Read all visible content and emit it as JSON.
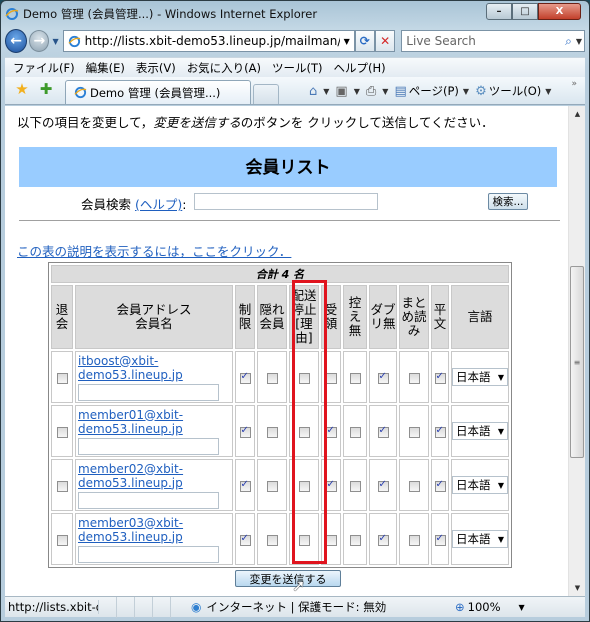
{
  "window": {
    "title": "Demo 管理 (会員管理...) - Windows Internet Explorer",
    "controls": {
      "minimize": "–",
      "maximize": "□",
      "close": "X"
    }
  },
  "nav": {
    "back_icon": "←",
    "forward_icon": "→",
    "address": "http://lists.xbit-demo53.lineup.jp/mailman/",
    "refresh_icon": "⟳",
    "stop_icon": "✕",
    "search_placeholder": "Live Search",
    "search_icon": "⌕"
  },
  "menu": [
    "ファイル(F)",
    "編集(E)",
    "表示(V)",
    "お気に入り(A)",
    "ツール(T)",
    "ヘルプ(H)"
  ],
  "tabs": {
    "active": "Demo 管理 (会員管理...)"
  },
  "command_bar": {
    "page_label": "ページ(P)",
    "tools_label": "ツール(O)",
    "chevron": "»"
  },
  "page": {
    "intro_before": "以下の項目を変更して，",
    "intro_emph": "変更を送信する",
    "intro_after": "のボタンを クリックして送信してください．",
    "banner_title": "会員リスト",
    "search_label": "会員検索 ",
    "search_help": "(ヘルプ)",
    "search_colon": ":",
    "search_value": "",
    "search_button": "検索...",
    "help_link": "この表の説明を表示するには，ここをクリック．",
    "total": "合計 4 名",
    "columns": {
      "unsub": [
        "退",
        "会"
      ],
      "address": [
        "会員アドレス",
        "会員名"
      ],
      "moderated": [
        "制",
        "限"
      ],
      "hidden": [
        "隠れ",
        "会員"
      ],
      "nomail": [
        "配送",
        "停止",
        "[理",
        "由]"
      ],
      "ack": [
        "受",
        "領"
      ],
      "notmetoo": [
        "控",
        "え",
        "無"
      ],
      "nodupes": [
        "ダブ",
        "リ無"
      ],
      "digest": [
        "まと",
        "め読",
        "み"
      ],
      "plain": [
        "平",
        "文"
      ],
      "language": "言語"
    },
    "members": [
      {
        "addr1": "itboost@xbit-",
        "addr2": "demo53.lineup.jp",
        "name": "",
        "unsub": false,
        "moderated": true,
        "hidden": false,
        "nomail": false,
        "ack": false,
        "notmetoo": false,
        "nodupes": true,
        "digest": false,
        "plain": true,
        "language": "日本語"
      },
      {
        "addr1": "member01@xbit-",
        "addr2": "demo53.lineup.jp",
        "name": "",
        "unsub": false,
        "moderated": true,
        "hidden": false,
        "nomail": false,
        "ack": true,
        "notmetoo": false,
        "nodupes": true,
        "digest": false,
        "plain": true,
        "language": "日本語"
      },
      {
        "addr1": "member02@xbit-",
        "addr2": "demo53.lineup.jp",
        "name": "",
        "unsub": false,
        "moderated": true,
        "hidden": false,
        "nomail": false,
        "ack": true,
        "notmetoo": false,
        "nodupes": true,
        "digest": false,
        "plain": true,
        "language": "日本語"
      },
      {
        "addr1": "member03@xbit-",
        "addr2": "demo53.lineup.jp",
        "name": "",
        "unsub": false,
        "moderated": true,
        "hidden": false,
        "nomail": false,
        "ack": false,
        "notmetoo": false,
        "nodupes": true,
        "digest": false,
        "plain": true,
        "language": "日本語"
      }
    ],
    "submit_button": "変更を送信する",
    "highlight_color": "#e0141e",
    "banner_color": "#99ccff"
  },
  "status": {
    "url": "http://lists.xbit-den",
    "zone": "インターネット | 保護モード: 無効",
    "zoom": "100%"
  }
}
